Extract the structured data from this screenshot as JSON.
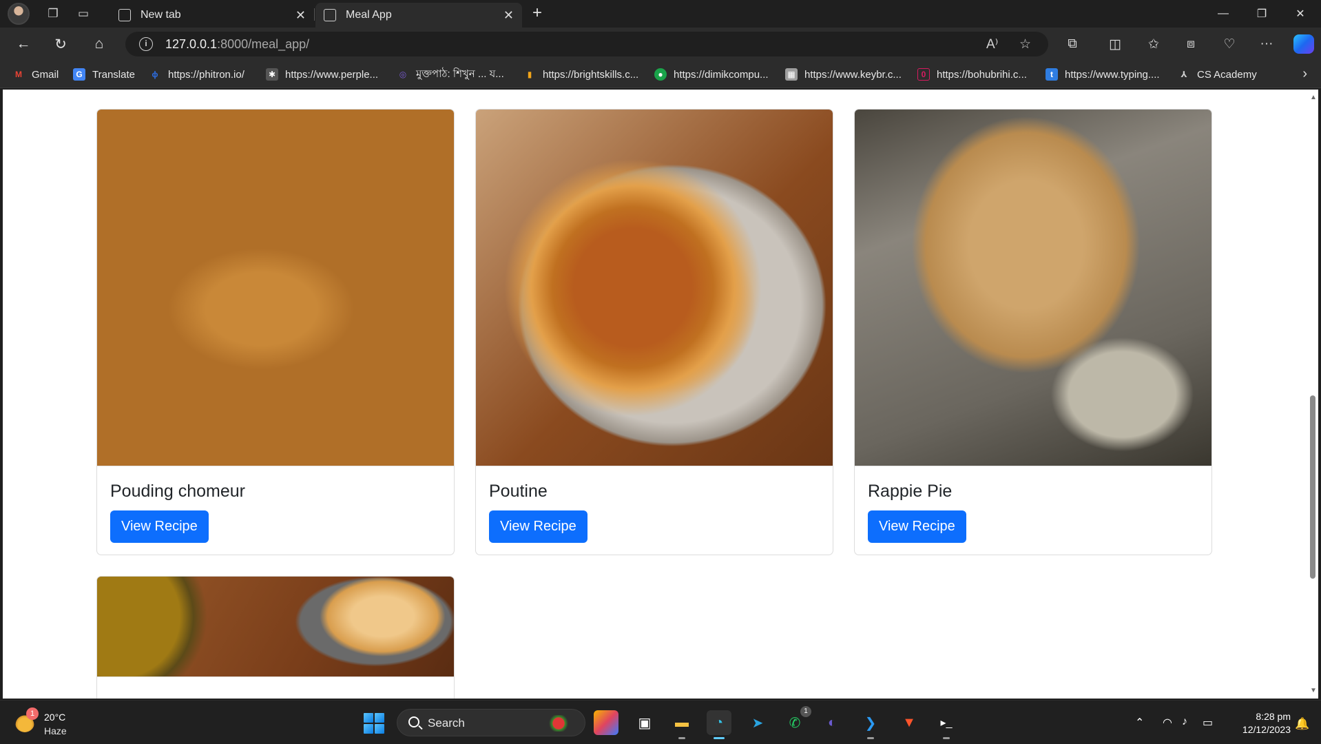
{
  "browser": {
    "tabs": [
      {
        "title": "New tab",
        "active": false
      },
      {
        "title": "Meal App",
        "active": true
      }
    ],
    "url_host": "127.0.0.1",
    "url_path": ":8000/meal_app/",
    "bookmarks": [
      {
        "label": "Gmail",
        "icon": "gmail-icon",
        "color": "#ea4335"
      },
      {
        "label": "Translate",
        "icon": "translate-icon",
        "color": "#4285f4"
      },
      {
        "label": "https://phitron.io/",
        "icon": "phitron-icon",
        "color": "#2d6cdf"
      },
      {
        "label": "https://www.perple...",
        "icon": "perplexity-icon",
        "color": "#555555"
      },
      {
        "label": "মুক্তপাঠ: শিখুন ... য...",
        "icon": "muktopaath-icon",
        "color": "#7b5cd6"
      },
      {
        "label": "https://brightskills.c...",
        "icon": "brightskills-icon",
        "color": "#f2a51a"
      },
      {
        "label": "https://dimikcompu...",
        "icon": "dimik-icon",
        "color": "#1aa34a"
      },
      {
        "label": "https://www.keybr.c...",
        "icon": "keybr-icon",
        "color": "#9e9e9e"
      },
      {
        "label": "https://bohubrihi.c...",
        "icon": "bohubrihi-icon",
        "color": "#d81b60"
      },
      {
        "label": "https://www.typing....",
        "icon": "typing-icon",
        "color": "#2f7de1"
      },
      {
        "label": "CS Academy",
        "icon": "cs-academy-icon",
        "color": "#cccccc"
      }
    ]
  },
  "meals": [
    {
      "name": "Pouding chomeur",
      "button": "View Recipe",
      "image": "pouding-chomeur-photo"
    },
    {
      "name": "Poutine",
      "button": "View Recipe",
      "image": "poutine-photo"
    },
    {
      "name": "Rappie Pie",
      "button": "View Recipe",
      "image": "rappie-pie-photo"
    },
    {
      "name": "",
      "button": "",
      "image": "soup-and-biscuits-photo"
    }
  ],
  "taskbar": {
    "weather_temp": "20°C",
    "weather_cond": "Haze",
    "weather_badge": "1",
    "search_placeholder": "Search",
    "time": "8:28 pm",
    "date": "12/12/2023",
    "whatsapp_badge": "1"
  },
  "colors": {
    "primary_button": "#0d6efd",
    "browser_chrome": "#2c2c2c",
    "taskbar": "#202020"
  }
}
